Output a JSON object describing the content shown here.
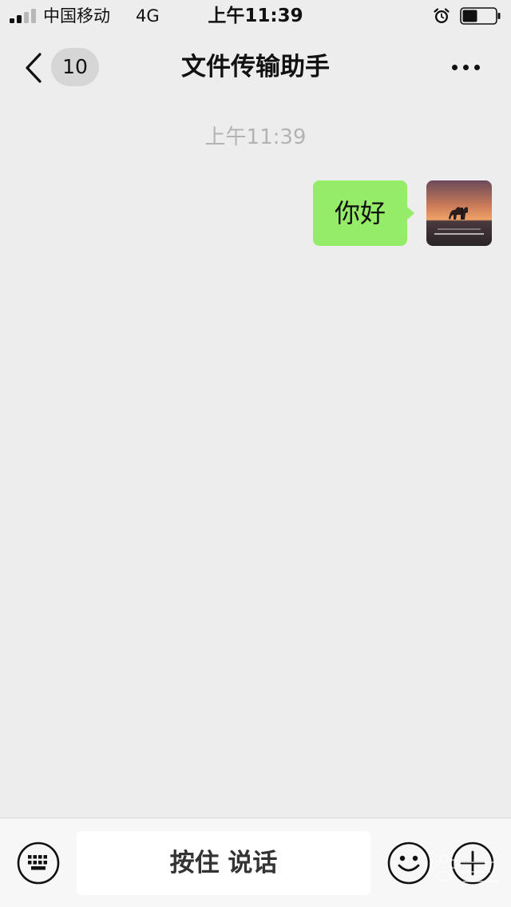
{
  "status_bar": {
    "carrier": "中国移动",
    "network": "4G",
    "time": "上午11:39",
    "battery_level": 0.45,
    "signal_bars_filled": 2,
    "signal_bars_total": 4,
    "icons": [
      "signal-icon",
      "alarm-icon",
      "battery-icon"
    ]
  },
  "nav": {
    "back_icon": "chevron-left-icon",
    "unread_count": "10",
    "title": "文件传输助手",
    "more_icon": "ellipsis-icon"
  },
  "chat": {
    "timestamp": "上午11:39",
    "messages": [
      {
        "text": "你好",
        "sender": "self",
        "bubble_color": "#95ec69"
      }
    ]
  },
  "input_bar": {
    "hold_to_talk_label": "按住 说话",
    "icons": [
      "keyboard-icon",
      "emoji-icon",
      "plus-icon"
    ]
  },
  "colors": {
    "background": "#ededed",
    "bubble_self": "#95ec69",
    "input_bar_bg": "#f7f7f7"
  }
}
